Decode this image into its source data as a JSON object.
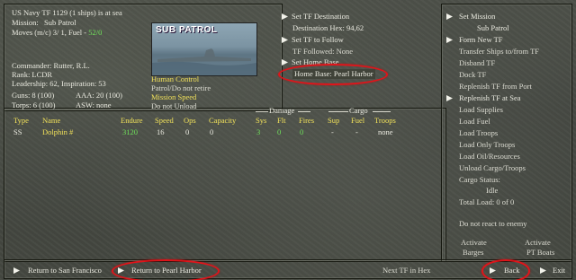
{
  "header": {
    "tf_title": "US Navy TF 1129 (1 ships) is at sea",
    "mission_label": "Mission:",
    "mission_value": "Sub Patrol",
    "moves_prefix": "Moves (m/c) 3/ 1, Fuel - ",
    "fuel_value": "52/0",
    "commander": "Commander: Rutter, R.L.",
    "rank": "Rank: LCDR",
    "leadership": "Leadership: 62, Inspiration: 53",
    "guns": "Guns: 8 (100)",
    "aaa": "AAA: 20 (100)",
    "torps": "Torps: 6 (100)",
    "asw": "ASW: none"
  },
  "photo": {
    "caption": "SUB PATROL"
  },
  "control": {
    "human_control": "Human Control",
    "patrol": "Patrol/Do not retire",
    "mission_speed": "Mission Speed",
    "do_not_unload": "Do not Unload"
  },
  "destination": {
    "set_tf_destination": "Set TF Destination",
    "destination_hex": "Destination Hex: 94,62",
    "set_tf_to_follow": "Set TF to Follow",
    "tf_followed": "TF Followed: None",
    "set_home_base": "Set Home Base",
    "home_base": "Home Base: Pearl Harbor"
  },
  "table": {
    "group_damage": "Damage",
    "group_cargo": "Cargo",
    "columns": [
      "Type",
      "Name",
      "Endure",
      "Speed",
      "Ops",
      "Capacity",
      "Sys",
      "Flt",
      "Fires",
      "Sup",
      "Fuel",
      "Troops"
    ],
    "row": {
      "type": "SS",
      "name": "Dolphin #",
      "endure": "3120",
      "speed": "16",
      "ops": "0",
      "capacity": "0",
      "sys": "3",
      "flt": "0",
      "fires": "0",
      "sup": "-",
      "fuel": "-",
      "troops": "none"
    }
  },
  "right_menu": {
    "set_mission": "Set Mission",
    "mission_value": "Sub Patrol",
    "form_new_tf": "Form New TF",
    "transfer_ships": "Transfer Ships to/from TF",
    "disband_tf": "Disband TF",
    "dock_tf": "Dock TF",
    "replenish_port": "Replenish TF from Port",
    "replenish_sea": "Replenish TF at Sea",
    "load_supplies": "Load Supplies",
    "load_fuel": "Load Fuel",
    "load_troops": "Load Troops",
    "load_only_troops": "Load Only Troops",
    "load_oil": "Load Oil/Resources",
    "unload_cargo": "Unload Cargo/Troops",
    "cargo_status": "Cargo Status:",
    "cargo_status_value": "Idle",
    "total_load": "Total Load: 0 of 0",
    "do_not_react": "Do not react to enemy",
    "activate_1": "Activate",
    "barges": "Barges",
    "activate_2": "Activate",
    "pt_boats": "PT Boats"
  },
  "bottom": {
    "return_sf": "Return to San Francisco",
    "return_ph": "Return to Pearl Harbor",
    "next_tf": "Next TF in Hex",
    "back": "Back",
    "exit": "Exit"
  },
  "colors": {
    "highlight_yellow": "#f0e05a",
    "value_green": "#6fe05a",
    "annotation_red": "#e0141a"
  }
}
